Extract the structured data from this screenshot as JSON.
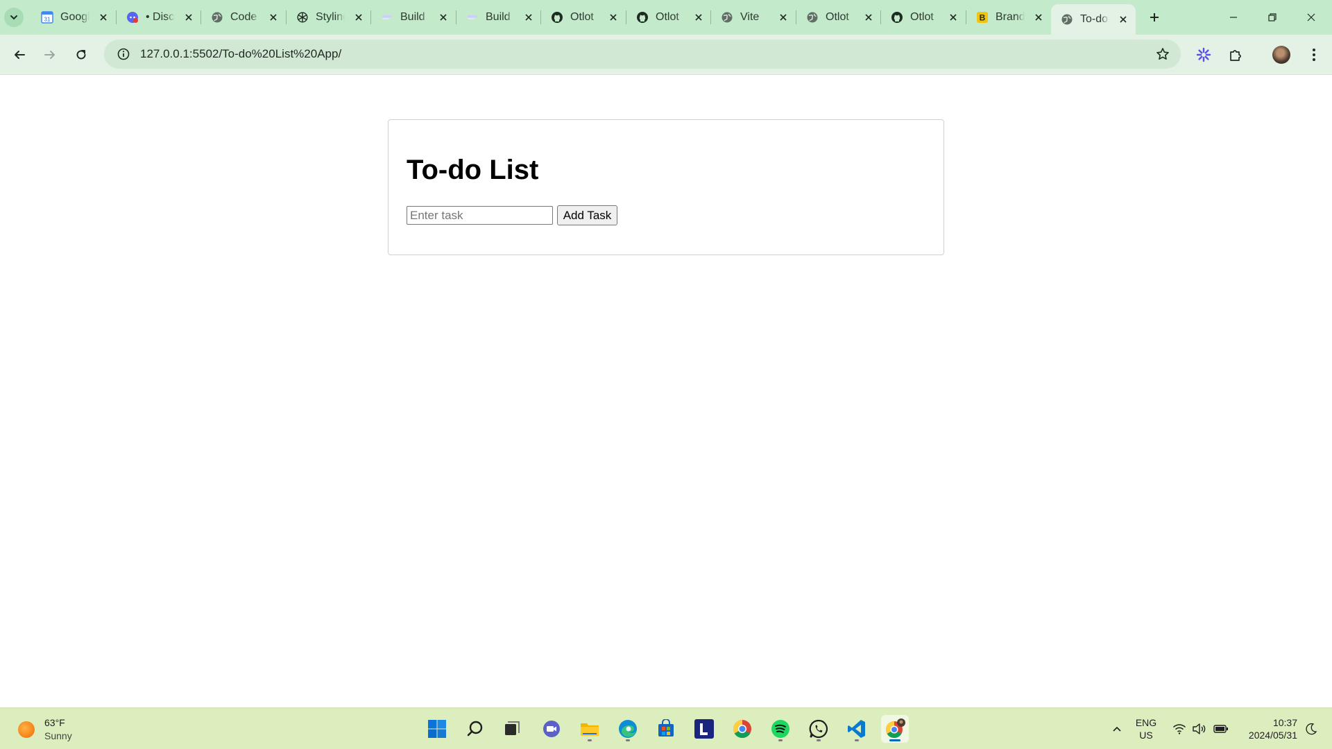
{
  "browser": {
    "tabs": [
      {
        "title": "Google Calendar",
        "icon": "google-calendar-icon",
        "active": false
      },
      {
        "title": "• Discord",
        "icon": "discord-icon",
        "active": false
      },
      {
        "title": "Code",
        "icon": "globe-icon",
        "active": false
      },
      {
        "title": "Styling",
        "icon": "openai-icon",
        "active": false
      },
      {
        "title": "Build",
        "icon": "document-icon",
        "active": false
      },
      {
        "title": "Build",
        "icon": "document-icon",
        "active": false
      },
      {
        "title": "Otlot",
        "icon": "github-icon",
        "active": false
      },
      {
        "title": "Otlot",
        "icon": "github-icon",
        "active": false
      },
      {
        "title": "Vite",
        "icon": "globe-icon",
        "active": false
      },
      {
        "title": "Otlot",
        "icon": "globe-icon",
        "active": false
      },
      {
        "title": "Otlot",
        "icon": "github-icon",
        "active": false
      },
      {
        "title": "Brand",
        "icon": "bootstrap-icon",
        "active": false
      },
      {
        "title": "To-do",
        "icon": "globe-icon",
        "active": true
      }
    ],
    "url": "127.0.0.1:5502/To-do%20List%20App/"
  },
  "page": {
    "heading": "To-do List",
    "input_placeholder": "Enter task",
    "input_value": "",
    "add_button_label": "Add Task"
  },
  "taskbar": {
    "weather_temp": "63°F",
    "weather_condition": "Sunny",
    "apps": [
      "start",
      "search",
      "task-view",
      "meet",
      "file-explorer",
      "edge",
      "store",
      "l-app",
      "chrome",
      "spotify",
      "whatsapp",
      "vscode",
      "chrome-profile"
    ],
    "lang_line1": "ENG",
    "lang_line2": "US",
    "time": "10:37",
    "date": "2024/05/31"
  },
  "colors": {
    "tabstrip": "#c2eacb",
    "toolbar": "#e4f2e6",
    "omnibox": "#d1e8d5",
    "taskbar": "#ddeebe",
    "accent": "#0067c0"
  }
}
